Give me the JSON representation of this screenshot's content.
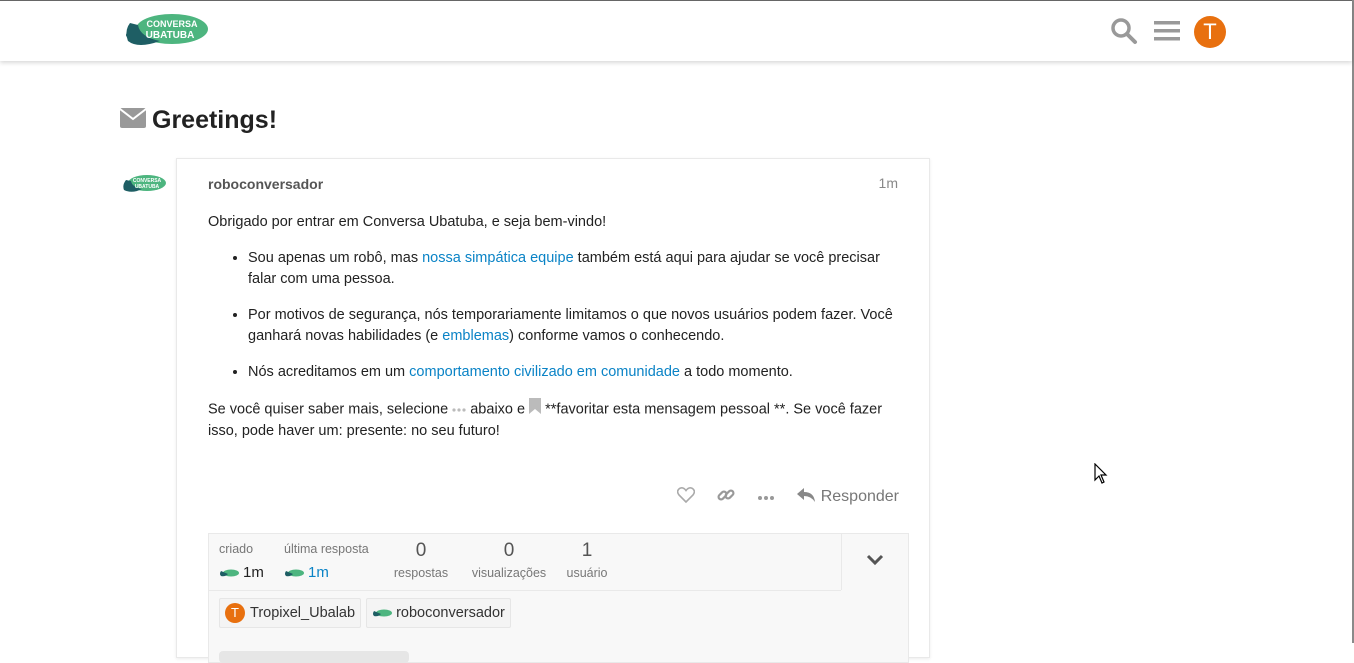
{
  "header": {
    "logo_line1": "CONVERSA",
    "logo_line2": "UBATUBA",
    "user_initial": "T",
    "accent_color": "#e8700f",
    "icons": [
      "search-icon",
      "hamburger-menu-icon"
    ]
  },
  "topic": {
    "title": "Greetings!",
    "title_icon": "envelope-icon"
  },
  "post": {
    "username": "roboconversador",
    "time": "1m",
    "intro": "Obrigado por entrar em Conversa Ubatuba, e seja bem-vindo!",
    "bullets": [
      {
        "pre": "Sou apenas um robô, mas ",
        "link": "nossa simpática equipe",
        "post": " também está aqui para ajudar se você precisar falar com uma pessoa."
      },
      {
        "pre": "Por motivos de segurança, nós temporariamente limitamos o que novos usuários podem fazer. Você ganhará novas habilidades (e ",
        "link": "emblemas",
        "post": ") conforme vamos o conhecendo."
      },
      {
        "pre": "Nós acreditamos em um ",
        "link": "comportamento civilizado em comunidade",
        "post": " a todo momento."
      }
    ],
    "closing_part1": "Se você quiser saber mais, selecione ",
    "closing_part2": " abaixo e ",
    "closing_part3": " **favoritar esta mensagem pessoal **. Se você fazer isso, pode haver um: presente: no seu futuro!",
    "link_color": "#0a83c6",
    "actions": {
      "reply_label": "Responder",
      "icons": [
        "heart-icon",
        "link-icon",
        "more-icon",
        "reply-icon"
      ]
    }
  },
  "topic_map": {
    "created_label": "criado",
    "created_value": "1m",
    "last_reply_label": "última resposta",
    "last_reply_value": "1m",
    "stats": [
      {
        "num": "0",
        "label": "respostas"
      },
      {
        "num": "0",
        "label": "visualizações"
      },
      {
        "num": "1",
        "label": "usuário"
      }
    ],
    "participants": [
      {
        "name": "Tropixel_Ubalab",
        "initial": "T"
      },
      {
        "name": "roboconversador"
      }
    ]
  }
}
